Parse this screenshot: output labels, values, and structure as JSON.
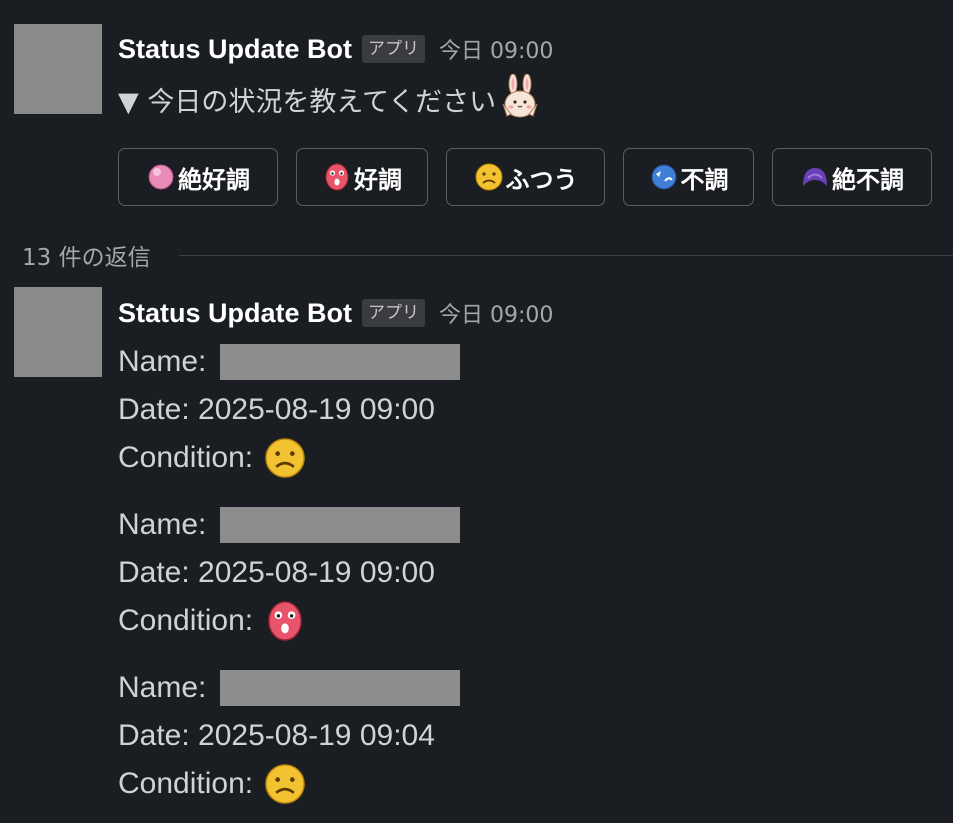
{
  "message": {
    "bot_name": "Status Update Bot",
    "app_badge": "アプリ",
    "timestamp": "今日 09:00",
    "prompt_text": "▼ 今日の状況を教えてください"
  },
  "buttons": [
    {
      "label": "絶好調",
      "icon": "pink-ball-emoji"
    },
    {
      "label": "好調",
      "icon": "surprised-red-face-emoji"
    },
    {
      "label": "ふつう",
      "icon": "worried-yellow-face-emoji"
    },
    {
      "label": "不調",
      "icon": "blue-face-emoji"
    },
    {
      "label": "絶不調",
      "icon": "purple-blob-emoji"
    }
  ],
  "thread": {
    "reply_count": "13 件の返信"
  },
  "reply": {
    "bot_name": "Status Update Bot",
    "app_badge": "アプリ",
    "timestamp": "今日 09:00",
    "entries": [
      {
        "name_label": "Name:",
        "date_text": "Date: 2025-08-19 09:00",
        "condition_label": "Condition:",
        "condition_icon": "worried-yellow-face-emoji"
      },
      {
        "name_label": "Name:",
        "date_text": "Date: 2025-08-19 09:00",
        "condition_label": "Condition:",
        "condition_icon": "surprised-red-face-emoji"
      },
      {
        "name_label": "Name:",
        "date_text": "Date: 2025-08-19 09:04",
        "condition_label": "Condition:",
        "condition_icon": "worried-yellow-face-emoji"
      }
    ]
  }
}
